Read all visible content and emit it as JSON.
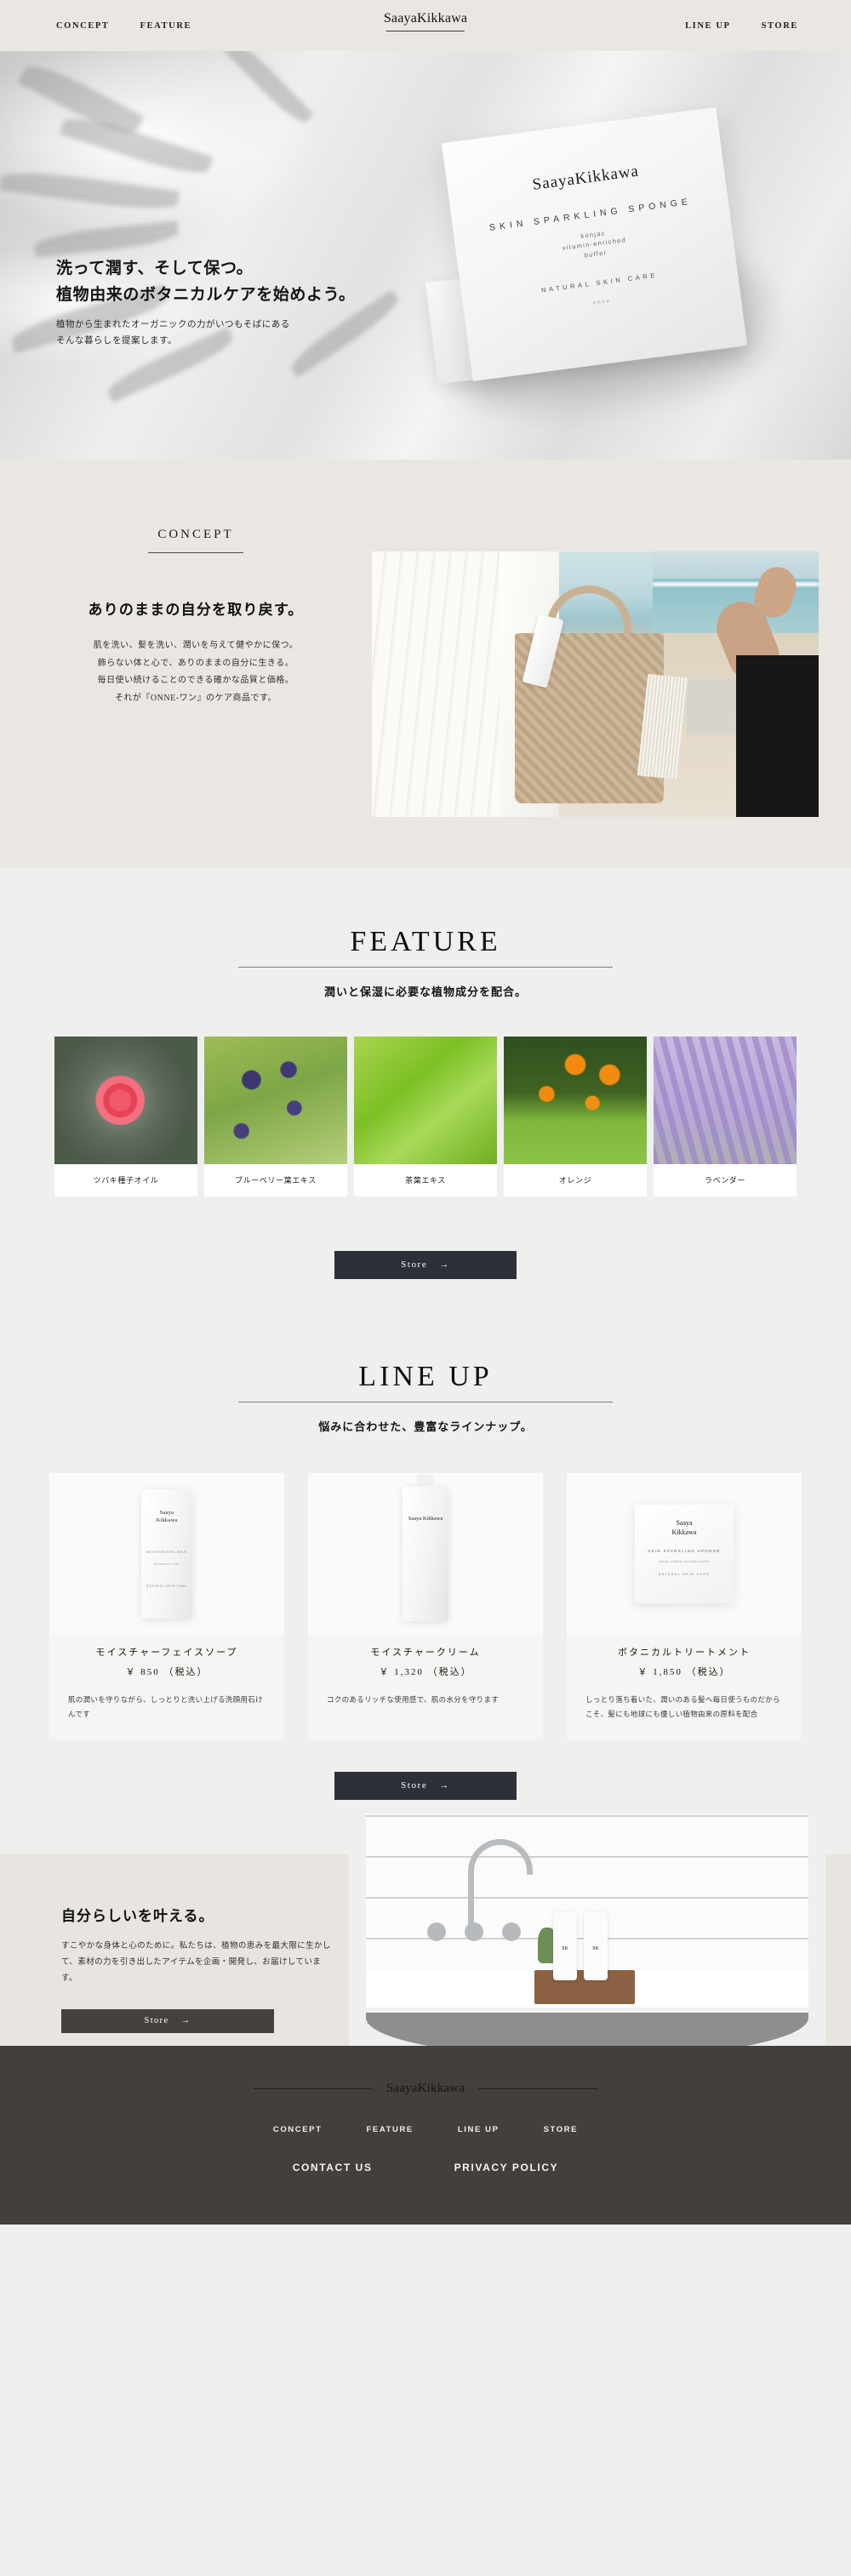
{
  "header": {
    "brand": "SaayaKikkawa",
    "nav_left": [
      {
        "label": "CONCEPT"
      },
      {
        "label": "FEATURE"
      }
    ],
    "nav_right": [
      {
        "label": "LINE UP"
      },
      {
        "label": "STORE"
      }
    ]
  },
  "hero": {
    "headline_line1": "洗って潤す、そして保つ。",
    "headline_line2": "植物由来のボタニカルケアを始めよう。",
    "sub_line1": "植物から生まれたオーガニックの力がいつもそばにある",
    "sub_line2": "そんな暮らしを提案します。",
    "package": {
      "brand": "SaayaKikkawa",
      "tagline": "SKIN SPARKLING SPONGE",
      "detail": "konjac\nvitamin-enriched\nbuffer",
      "footline": "NATURAL SKIN CARE",
      "mark": "onne"
    }
  },
  "concept": {
    "label": "CONCEPT",
    "heading": "ありのままの自分を取り戻す。",
    "body_lines": [
      "肌を洗い、髪を洗い、潤いを与えて健やかに保つ。",
      "飾らない体と心で、ありのままの自分に生きる。",
      "毎日使い続けることのできる確かな品質と価格。",
      "それが『ONNE-ワン』のケア商品です。"
    ],
    "image_alt": "beach-lifestyle-photo"
  },
  "feature": {
    "heading": "FEATURE",
    "subheading": "潤いと保湿に必要な植物成分を配合。",
    "items": [
      {
        "name": "ツバキ種子オイル",
        "image": "camellia-flower-photo"
      },
      {
        "name": "ブルーベリー葉エキス",
        "image": "blueberry-photo"
      },
      {
        "name": "茶葉エキス",
        "image": "tea-leaf-photo"
      },
      {
        "name": "オレンジ",
        "image": "orange-grove-photo"
      },
      {
        "name": "ラベンダー",
        "image": "lavender-field-photo"
      }
    ],
    "store_button": "Store",
    "store_arrow": "→"
  },
  "lineup": {
    "heading": "LINE UP",
    "subheading": "悩みに合わせた、豊富なラインナップ。",
    "products": [
      {
        "name": "モイスチャーフェイスソープ",
        "price": "￥ 850 （税込）",
        "description": "肌の潤いを守りながら、しっとりと洗い上げる洗顔用石けんです",
        "pkg_brand": "Saaya\nKikkawa",
        "pkg_type": "tube"
      },
      {
        "name": "モイスチャークリーム",
        "price": "￥ 1,320 （税込）",
        "description": "コクのあるリッチな使用感で、肌の水分を守ります",
        "pkg_brand": "Saaya\nKikkawa",
        "pkg_type": "bottle"
      },
      {
        "name": "ボタニカルトリートメント",
        "price": "￥ 1,850 （税込）",
        "description": "しっとり落ち着いた、潤いのある髪へ毎日使うものだからこそ、髪にも地球にも優しい植物由来の原料を配合",
        "pkg_brand": "Saaya\nKikkawa",
        "pkg_tag": "SKIN SPARKLING SPONGE",
        "pkg_note": "konjac vitamin-enriched buffer",
        "pkg_foot": "NATURAL SKIN CARE",
        "pkg_type": "box"
      }
    ],
    "store_button": "Store",
    "store_arrow": "→"
  },
  "cta": {
    "heading": "自分らしいを叶える。",
    "body": "すこやかな身体と心のために。私たちは、植物の恵みを最大限に生かして、素材の力を引き出したアイテムを企画・開発し、お届けしています。",
    "store_button": "Store",
    "store_arrow": "→",
    "image_alt": "bathroom-tub-products-photo",
    "bottle_label": "SK"
  },
  "footer": {
    "brand": "SaayaKikkawa",
    "nav": [
      {
        "label": "CONCEPT"
      },
      {
        "label": "FEATURE"
      },
      {
        "label": "LINE UP"
      },
      {
        "label": "STORE"
      }
    ],
    "secondary_nav": [
      {
        "label": "CONTACT US"
      },
      {
        "label": "PRIVACY POLICY"
      }
    ]
  },
  "colors": {
    "page_bg": "#efefed",
    "header_bg": "#eae7e2",
    "concept_bg": "#eae7e2",
    "cta_bg": "#e8e5e0",
    "footer_bg": "#433f3b",
    "button_dark": "#2d3038",
    "text": "#1d1d1d"
  }
}
